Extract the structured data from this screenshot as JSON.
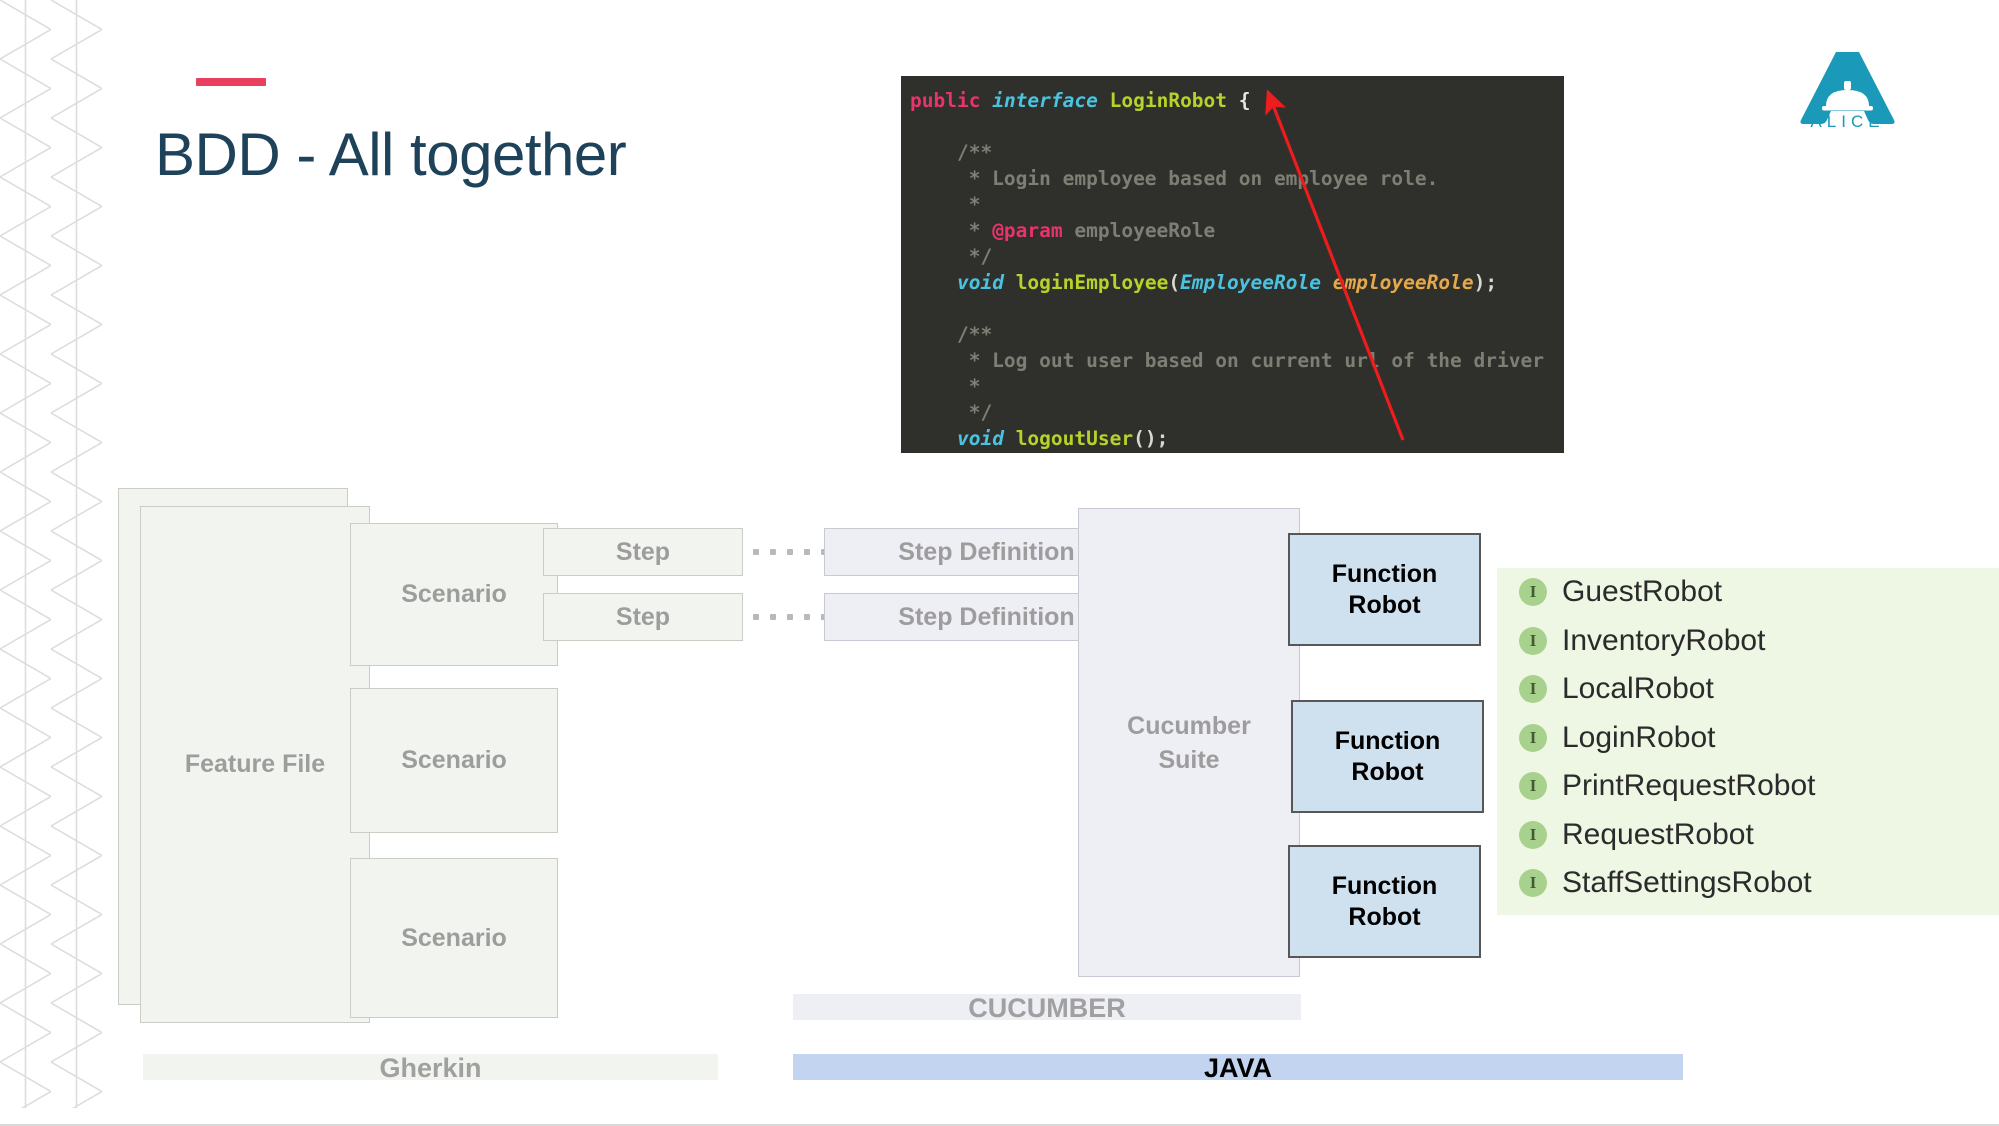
{
  "slide": {
    "title": "BDD - All together",
    "accent_color": "#e8405e",
    "title_color": "#1d4259"
  },
  "logo": {
    "name": "alice-logo",
    "text": "ALICE",
    "color": "#1a9ab8"
  },
  "code": {
    "language": "java",
    "background": "#2f302b",
    "lines": [
      {
        "tokens": [
          {
            "t": "public",
            "c": "c-kw"
          },
          {
            "t": " ",
            "c": "c-punc"
          },
          {
            "t": "interface",
            "c": "c-iface"
          },
          {
            "t": " ",
            "c": "c-punc"
          },
          {
            "t": "LoginRobot",
            "c": "c-type"
          },
          {
            "t": " {",
            "c": "c-brace"
          }
        ]
      },
      {
        "tokens": []
      },
      {
        "tokens": [
          {
            "t": "    ",
            "c": "c-punc"
          },
          {
            "t": "/**",
            "c": "c-cmt"
          }
        ]
      },
      {
        "tokens": [
          {
            "t": "     ",
            "c": "c-punc"
          },
          {
            "t": "* Login employee based on employee role.",
            "c": "c-cmt"
          }
        ]
      },
      {
        "tokens": [
          {
            "t": "     ",
            "c": "c-punc"
          },
          {
            "t": "*",
            "c": "c-cmt"
          }
        ]
      },
      {
        "tokens": [
          {
            "t": "     ",
            "c": "c-punc"
          },
          {
            "t": "* ",
            "c": "c-cmt"
          },
          {
            "t": "@param",
            "c": "c-param"
          },
          {
            "t": " employeeRole",
            "c": "c-cmt"
          }
        ]
      },
      {
        "tokens": [
          {
            "t": "     ",
            "c": "c-punc"
          },
          {
            "t": "*/",
            "c": "c-cmt"
          }
        ]
      },
      {
        "tokens": [
          {
            "t": "    ",
            "c": "c-punc"
          },
          {
            "t": "void",
            "c": "c-void"
          },
          {
            "t": " ",
            "c": "c-punc"
          },
          {
            "t": "loginEmployee",
            "c": "c-fn"
          },
          {
            "t": "(",
            "c": "c-punc"
          },
          {
            "t": "EmployeeRole",
            "c": "c-argt"
          },
          {
            "t": " ",
            "c": "c-punc"
          },
          {
            "t": "employeeRole",
            "c": "c-arg"
          },
          {
            "t": ");",
            "c": "c-punc"
          }
        ]
      },
      {
        "tokens": []
      },
      {
        "tokens": [
          {
            "t": "    ",
            "c": "c-punc"
          },
          {
            "t": "/**",
            "c": "c-cmt"
          }
        ]
      },
      {
        "tokens": [
          {
            "t": "     ",
            "c": "c-punc"
          },
          {
            "t": "* Log out user based on current url of the driver",
            "c": "c-cmt"
          }
        ]
      },
      {
        "tokens": [
          {
            "t": "     ",
            "c": "c-punc"
          },
          {
            "t": "*",
            "c": "c-cmt"
          }
        ]
      },
      {
        "tokens": [
          {
            "t": "     ",
            "c": "c-punc"
          },
          {
            "t": "*/",
            "c": "c-cmt"
          }
        ]
      },
      {
        "tokens": [
          {
            "t": "    ",
            "c": "c-punc"
          },
          {
            "t": "void",
            "c": "c-void"
          },
          {
            "t": " ",
            "c": "c-punc"
          },
          {
            "t": "logoutUser",
            "c": "c-fn"
          },
          {
            "t": "();",
            "c": "c-punc"
          }
        ]
      }
    ]
  },
  "arrow": {
    "name": "red-pointer-arrow",
    "color": "#ee1c1c",
    "from": "function-robot-top",
    "to": "login-robot-interface-declaration"
  },
  "diagram": {
    "feature_file": {
      "label": "Feature File"
    },
    "scenarios": [
      {
        "label": "Scenario"
      },
      {
        "label": "Scenario"
      },
      {
        "label": "Scenario"
      }
    ],
    "steps": [
      {
        "label": "Step"
      },
      {
        "label": "Step"
      }
    ],
    "step_definitions": [
      {
        "label": "Step Definition"
      },
      {
        "label": "Step Definition"
      }
    ],
    "cucumber_suite": {
      "label": "Cucumber Suite",
      "line1": "Cucumber",
      "line2": "Suite"
    },
    "function_robots": [
      {
        "line1": "Function",
        "line2": "Robot"
      },
      {
        "line1": "Function",
        "line2": "Robot"
      },
      {
        "line1": "Function",
        "line2": "Robot"
      }
    ]
  },
  "lanes": {
    "gherkin": {
      "label": "Gherkin",
      "color": "#f2f5ef"
    },
    "cucumber": {
      "label": "CUCUMBER",
      "color": "#eeeef5"
    },
    "java": {
      "label": "JAVA",
      "color": "#c3d4f0"
    }
  },
  "robot_list": {
    "background": "#edf7e4",
    "icon_label": "I",
    "items": [
      {
        "name": "GuestRobot"
      },
      {
        "name": "InventoryRobot"
      },
      {
        "name": "LocalRobot"
      },
      {
        "name": "LoginRobot"
      },
      {
        "name": "PrintRequestRobot"
      },
      {
        "name": "RequestRobot"
      },
      {
        "name": "StaffSettingsRobot"
      }
    ]
  }
}
